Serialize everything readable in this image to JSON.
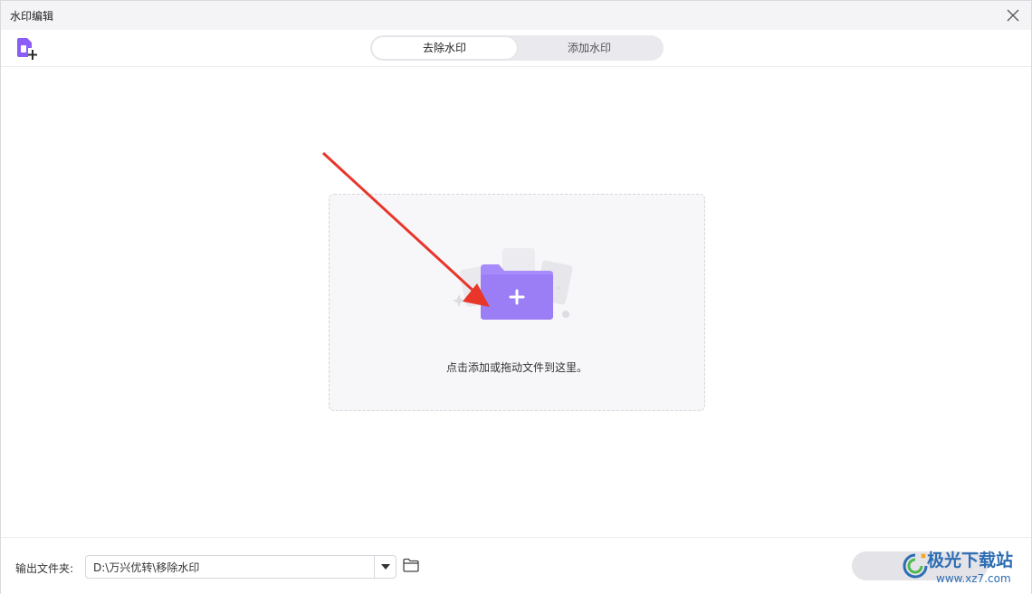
{
  "window": {
    "title": "水印编辑"
  },
  "tabs": {
    "remove_label": "去除水印",
    "add_label": "添加水印",
    "active": "去除水印"
  },
  "dropzone": {
    "text": "点击添加或拖动文件到这里。"
  },
  "footer": {
    "output_label": "输出文件夹:",
    "output_path": "D:\\万兴优转\\移除水印"
  },
  "watermark": {
    "name": "极光下载站",
    "url": "www.xz7.com"
  },
  "colors": {
    "accent": "#8b6cf0",
    "arrow": "#e8362b",
    "background": "#f7f7f9"
  },
  "icons": [
    "add-file-icon",
    "close-icon",
    "folder-plus-icon",
    "chevron-down-icon",
    "folder-icon"
  ]
}
